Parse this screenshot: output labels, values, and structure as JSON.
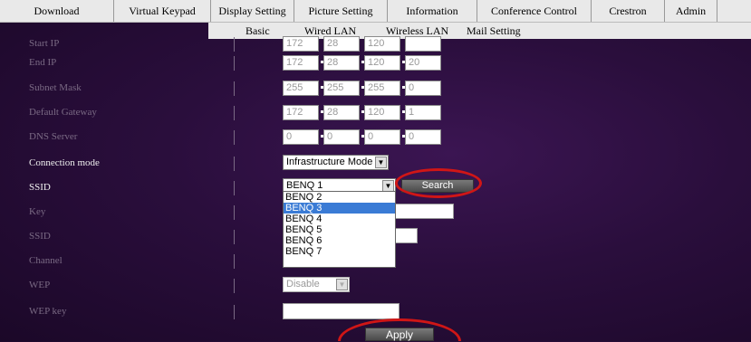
{
  "topnav": [
    "Download",
    "Virtual Keypad",
    "Display Setting",
    "Picture Setting",
    "Information",
    "Conference Control",
    "Crestron",
    "Admin"
  ],
  "subnav": [
    "Basic",
    "Wired LAN",
    "Wireless LAN",
    "Mail Setting"
  ],
  "rows": {
    "start_ip": {
      "label": "Start IP",
      "octets": [
        "172",
        "28",
        "120",
        ""
      ]
    },
    "end_ip": {
      "label": "End IP",
      "octets": [
        "172",
        "28",
        "120",
        "20"
      ]
    },
    "subnet": {
      "label": "Subnet Mask",
      "octets": [
        "255",
        "255",
        "255",
        "0"
      ]
    },
    "gateway": {
      "label": "Default Gateway",
      "octets": [
        "172",
        "28",
        "120",
        "1"
      ]
    },
    "dns": {
      "label": "DNS Server",
      "octets": [
        "0",
        "0",
        "0",
        "0"
      ]
    },
    "connection_mode": {
      "label": "Connection mode",
      "value": "Infrastructure Mode"
    },
    "ssid_top": {
      "label": "SSID",
      "value": "BENQ 1",
      "search": "Search"
    },
    "key": {
      "label": "Key"
    },
    "ssid": {
      "label": "SSID"
    },
    "channel": {
      "label": "Channel"
    },
    "wep": {
      "label": "WEP",
      "value": "Disable"
    },
    "wep_key": {
      "label": "WEP key"
    }
  },
  "dropdown": [
    "BENQ 2",
    "BENQ 3",
    "BENQ 4",
    "BENQ 5",
    "BENQ 6",
    "BENQ 7"
  ],
  "apply": "Apply",
  "icons": {
    "arrow": "▼"
  },
  "colors": {
    "annotation": "#d01616",
    "selected": "#3a7bd5"
  }
}
